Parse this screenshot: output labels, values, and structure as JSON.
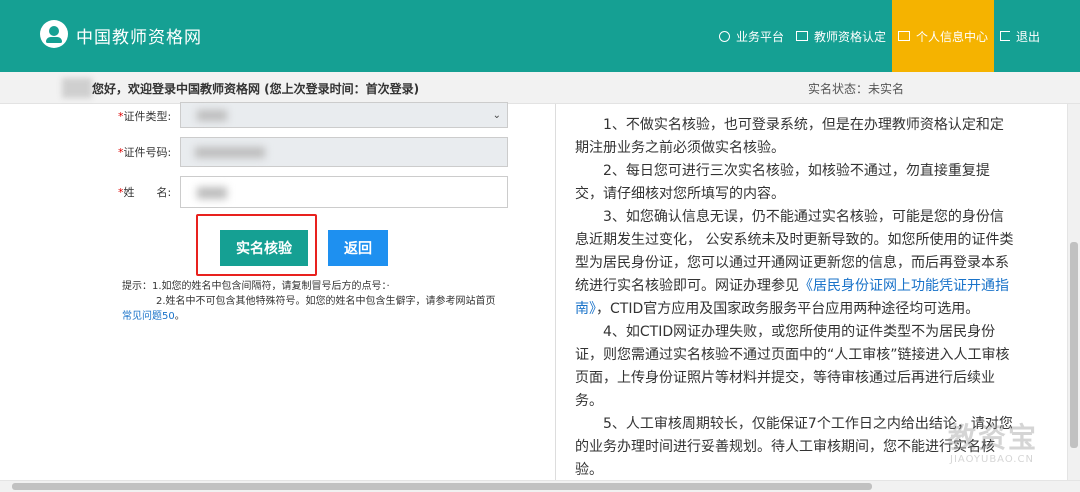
{
  "header": {
    "site_title": "中国教师资格网",
    "nav": [
      {
        "label": "业务平台",
        "icon": "dashboard-icon"
      },
      {
        "label": "教师资格认定",
        "icon": "monitor-icon"
      },
      {
        "label": "个人信息中心",
        "icon": "monitor-icon",
        "active": true
      },
      {
        "label": "退出",
        "icon": "logout-icon"
      }
    ]
  },
  "welcome": {
    "text": "您好，欢迎登录中国教师资格网 (您上次登录时间：首次登录)",
    "status": "实名状态：未实名"
  },
  "form": {
    "id_type_label": "证件类型:",
    "id_number_label": "证件号码:",
    "name_label": "姓　　名:",
    "required_mark": "*",
    "verify_button": "实名核验",
    "back_button": "返回"
  },
  "tips": {
    "line1": "提示：1.如您的姓名中包含间隔符，请复制冒号后方的点号：·",
    "line2": "2.姓名中不可包含其他特殊符号。如您的姓名中包含生僻字，请参考网站首页",
    "link": "常见问题50",
    "line2_end": "。"
  },
  "rules": {
    "p1": "1、不做实名核验，也可登录系统，但是在办理教师资格认定和定期注册业务之前必须做实名核验。",
    "p2": "2、每日您可进行三次实名核验，如核验不通过，勿直接重复提交，请仔细核对您所填写的内容。",
    "p3_a": "3、如您确认信息无误，仍不能通过实名核验，可能是您的身份信息近期发生过变化， 公安系统未及时更新导致的。如您所使用的证件类型为居民身份证，您可以通过开通网证更新您的信息，而后再登录本系统进行实名核验即可。网证办理参见",
    "p3_link": "《居民身份证网上功能凭证开通指南》",
    "p3_b": "，CTID官方应用及国家政务服务平台应用两种途径均可选用。",
    "p4": "4、如CTID网证办理失败，或您所使用的证件类型不为居民身份证，则您需通过实名核验不通过页面中的“人工审核”链接进入人工审核页面，上传身份证照片等材料并提交，等待审核通过后再进行后续业务。",
    "p5": "5、人工审核周期较长，仅能保证7个工作日之内给出结论，请对您的业务办理时间进行妥善规划。待人工审核期间，您不能进行实名核验。"
  },
  "watermark": {
    "text": "教资宝",
    "sub": "JIAOYUBAO.CN"
  },
  "colors": {
    "header": "#15a093",
    "active_nav": "#f5b300",
    "verify_button": "#15a093",
    "back_button": "#1e90f0",
    "highlight": "#e8211e",
    "link": "#1a73c9"
  }
}
